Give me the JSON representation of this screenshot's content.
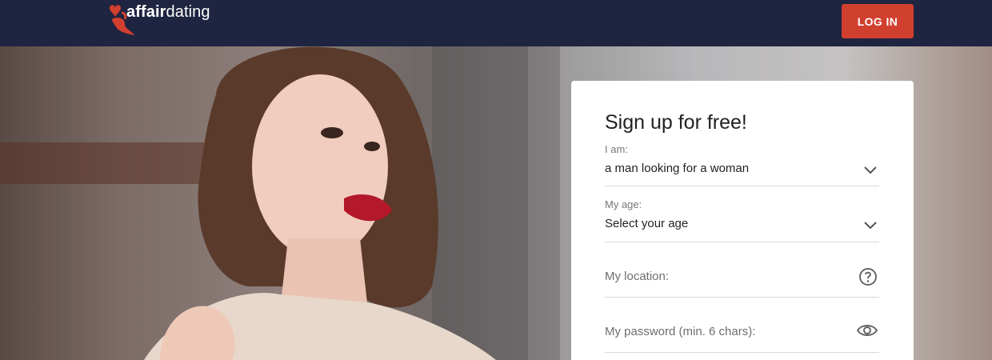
{
  "header": {
    "logo_bold": "affair",
    "logo_light": "dating",
    "login_label": "LOG IN",
    "brand_color": "#d13f2f",
    "bar_color": "#1f2440"
  },
  "signup": {
    "title": "Sign up for free!",
    "iam_label": "I am:",
    "iam_value": "a man looking for a woman",
    "age_label": "My age:",
    "age_value": "Select your age",
    "location_placeholder": "My location:",
    "password_placeholder": "My password (min. 6 chars):"
  },
  "icons": {
    "iam_dropdown": "chevron-down-icon",
    "age_dropdown": "chevron-down-icon",
    "location_help": "question-circle-icon",
    "password_toggle": "eye-icon"
  }
}
